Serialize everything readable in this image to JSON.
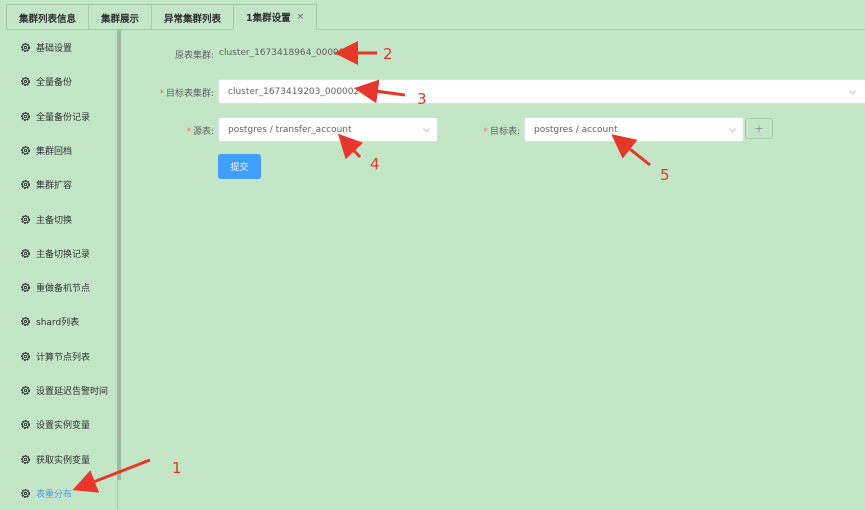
{
  "tabs": [
    {
      "label": "集群列表信息"
    },
    {
      "label": "集群展示"
    },
    {
      "label": "异常集群列表"
    },
    {
      "label": "1集群设置",
      "close": "×"
    }
  ],
  "sidebar": {
    "items": [
      {
        "label": "基础设置"
      },
      {
        "label": "全量备份"
      },
      {
        "label": "全量备份记录"
      },
      {
        "label": "集群回档"
      },
      {
        "label": "集群扩容"
      },
      {
        "label": "主备切换"
      },
      {
        "label": "主备切换记录"
      },
      {
        "label": "重做备机节点"
      },
      {
        "label": "shard列表"
      },
      {
        "label": "计算节点列表"
      },
      {
        "label": "设置延迟告警时间"
      },
      {
        "label": "设置实例变量"
      },
      {
        "label": "获取实例变量"
      },
      {
        "label": "表重分布",
        "active": true
      }
    ]
  },
  "form": {
    "source_cluster_label": "原表集群:",
    "source_cluster_value": "cluster_1673418964_000001",
    "target_cluster_label": "目标表集群:",
    "target_cluster_value": "cluster_1673419203_000002",
    "source_table_label": "源表:",
    "source_table_value": "postgres / transfer_account",
    "target_table_label": "目标表:",
    "target_table_value": "postgres / account",
    "required_mark": "*",
    "add_label": "+",
    "submit_label": "提交"
  },
  "annotations": {
    "n1": "1",
    "n2": "2",
    "n3": "3",
    "n4": "4",
    "n5": "5",
    "color": "#e8362b"
  }
}
